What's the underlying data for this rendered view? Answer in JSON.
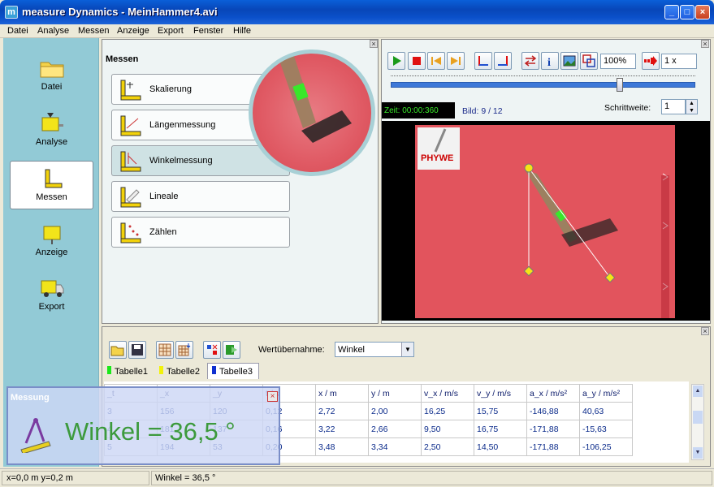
{
  "window": {
    "title": "measure Dynamics - MeinHammer4.avi",
    "app_icon": "m"
  },
  "menu": [
    "Datei",
    "Analyse",
    "Messen",
    "Anzeige",
    "Export",
    "Fenster",
    "Hilfe"
  ],
  "sidebar": {
    "items": [
      {
        "label": "Datei",
        "icon": "folder-icon"
      },
      {
        "label": "Analyse",
        "icon": "analyse-icon"
      },
      {
        "label": "Messen",
        "icon": "messen-icon"
      },
      {
        "label": "Anzeige",
        "icon": "display-icon"
      },
      {
        "label": "Export",
        "icon": "truck-icon"
      }
    ]
  },
  "messen_panel": {
    "title": "Messen",
    "buttons": [
      "Skalierung",
      "Längenmessung",
      "Winkelmessung",
      "Lineale",
      "Zählen"
    ]
  },
  "video_panel": {
    "zoom": "100%",
    "speed": "1 x",
    "time": "Zeit:  00:00:360",
    "frame": "Bild: 9 / 12",
    "step_label": "Schrittweite:",
    "step_value": "1",
    "logo": "PHYWE"
  },
  "data_panel": {
    "wertuebernahme_label": "Wertübernahme:",
    "wertuebernahme_value": "Winkel",
    "tabs": [
      "Tabelle1",
      "Tabelle2",
      "Tabelle3"
    ],
    "columns": [
      "_t",
      "_x",
      "_y",
      "t / s",
      "x / m",
      "y / m",
      "v_x / m/s",
      "v_y / m/s",
      "a_x / m/s²",
      "a_y / m/s²"
    ],
    "rows": [
      [
        "3",
        "156",
        "120",
        "0,12",
        "2,72",
        "2,00",
        "16,25",
        "15,75",
        "-146,88",
        "40,63"
      ],
      [
        "4",
        "181",
        "137",
        "0,16",
        "3,22",
        "2,66",
        "9,50",
        "16,75",
        "-171,88",
        "-15,63"
      ],
      [
        "5",
        "194",
        "53",
        "0,20",
        "3,48",
        "3,34",
        "2,50",
        "14,50",
        "-171,88",
        "-106,25"
      ]
    ]
  },
  "overlay": {
    "title": "Messung",
    "value": "Winkel  =  36,5 °"
  },
  "status": {
    "coords": "x=0,0 m  y=0,2 m",
    "measure": "Winkel  =  36,5 °"
  }
}
